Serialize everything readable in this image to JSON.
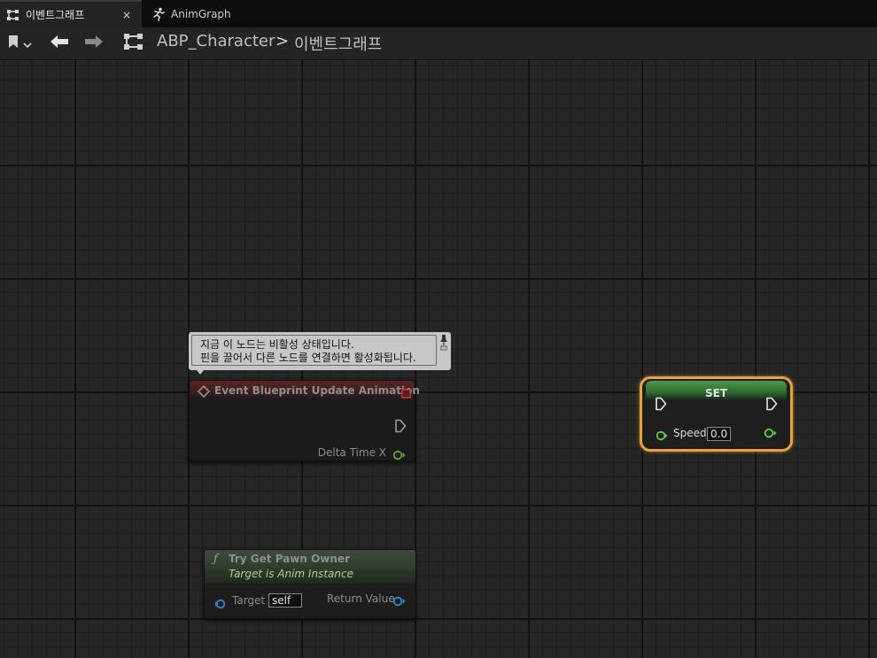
{
  "tabs": [
    {
      "label": "이벤트그래프",
      "close": "×"
    },
    {
      "label": "AnimGraph"
    }
  ],
  "breadcrumb": {
    "asset": "ABP_Character",
    "separator": ">",
    "graph": "이벤트그래프"
  },
  "tooltip": {
    "line1": "지금 이 노드는 비활성 상태입니다.",
    "line2": "핀을 끌어서 다른 노드를 연결하면 활성화됩니다."
  },
  "event_node": {
    "title": "Event Blueprint Update Animation",
    "output_pin": "Delta Time X"
  },
  "function_node": {
    "title": "Try Get Pawn Owner",
    "subtitle": "Target is Anim Instance",
    "input_pin": "Target",
    "input_value": "self",
    "output_pin": "Return Value"
  },
  "set_node": {
    "title": "SET",
    "pin": "Speed",
    "value": "0.0"
  },
  "colors": {
    "exec_pin": "#ffffff",
    "float_pin": "#7bd03c",
    "object_pin": "#2aa0e0",
    "selection_outline": "#e8a23a",
    "event_header": "#5a2424"
  }
}
